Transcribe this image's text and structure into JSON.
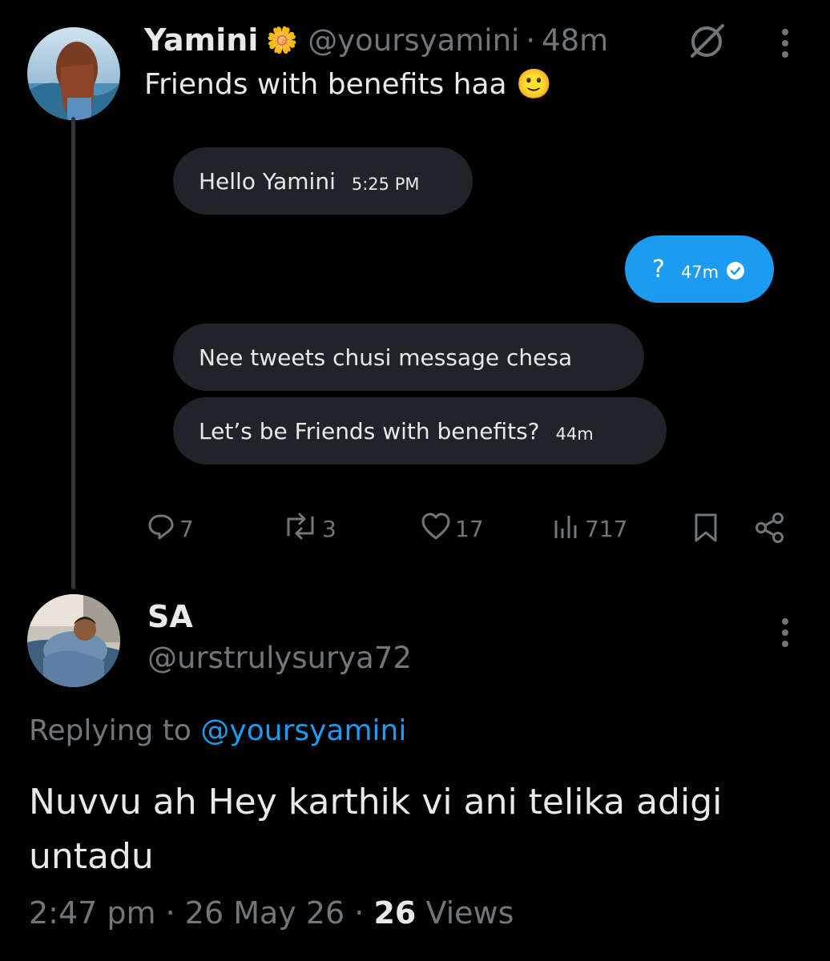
{
  "tweet": {
    "author_name": "Yamini",
    "badge_emoji": "🌼",
    "handle": "@yoursyamini",
    "time": "48m",
    "text": "Friends with benefits haa 🙂",
    "dm": [
      {
        "text": "Hello Yamini",
        "time": "5:25 PM",
        "side": "left"
      },
      {
        "text": "?",
        "time": "47m",
        "side": "right"
      },
      {
        "text": "Nee tweets chusi message chesa",
        "time": "",
        "side": "left"
      },
      {
        "text": "Let’s be Friends with benefits?",
        "time": "44m",
        "side": "left"
      }
    ],
    "stats": {
      "replies": "7",
      "reposts": "3",
      "likes": "17",
      "views": "717"
    }
  },
  "reply": {
    "author_name": "SA",
    "handle": "@urstrulysurya72",
    "replying_label": "Replying to",
    "replying_handle": "@yoursyamini",
    "text": "Nuvvu ah Hey karthik vi ani telika adigi untadu",
    "timestamp": "2:47 pm · 26 May 26 ·",
    "views_count": "26",
    "views_label": "Views"
  },
  "colors": {
    "background": "#000000",
    "text": "#e7e9ea",
    "muted": "#71767b",
    "accent": "#1d9bf0",
    "bubble": "#202327"
  },
  "icons": [
    "grok-icon",
    "more-icon",
    "reply-icon",
    "repost-icon",
    "like-icon",
    "views-icon",
    "bookmark-icon",
    "share-icon",
    "read-check-icon"
  ]
}
